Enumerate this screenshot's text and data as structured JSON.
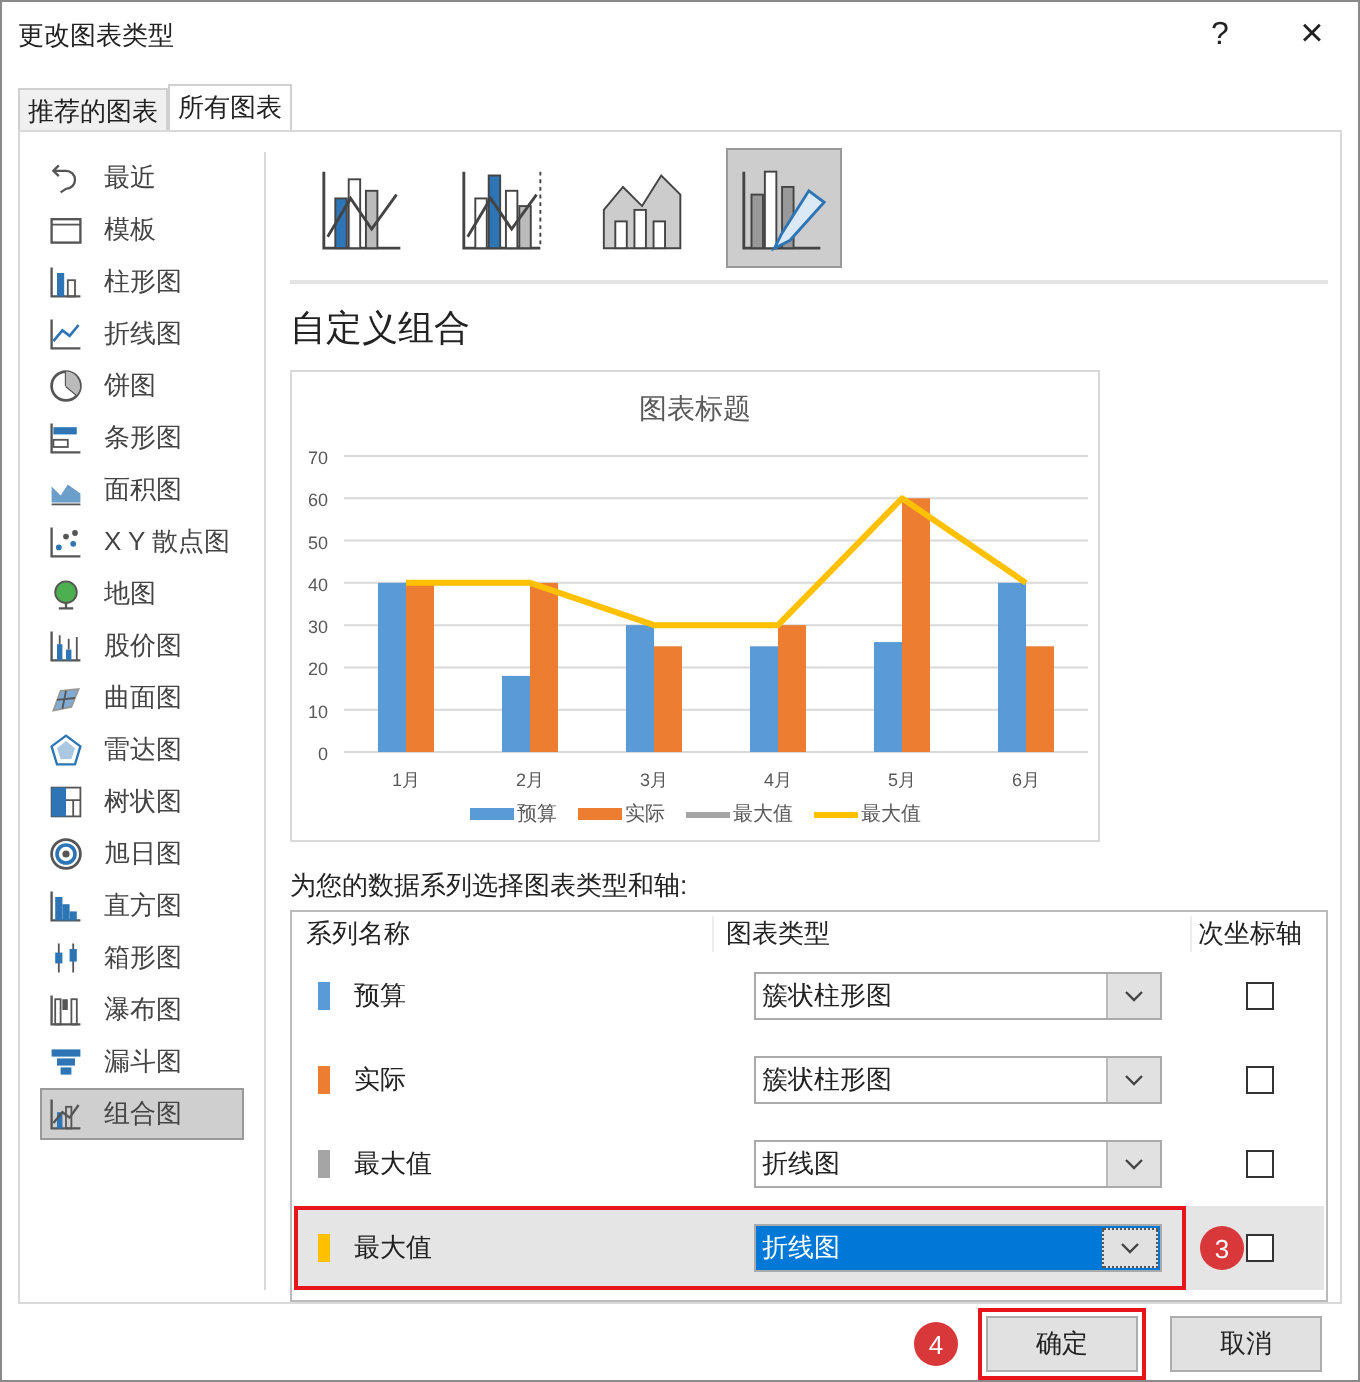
{
  "window": {
    "title": "更改图表类型",
    "help": "?",
    "close": "×"
  },
  "tabs": [
    {
      "label": "推荐的图表",
      "selected": false
    },
    {
      "label": "所有图表",
      "selected": true
    }
  ],
  "sidebar": {
    "items": [
      {
        "label": "最近",
        "selected": false
      },
      {
        "label": "模板",
        "selected": false
      },
      {
        "label": "柱形图",
        "selected": false
      },
      {
        "label": "折线图",
        "selected": false
      },
      {
        "label": "饼图",
        "selected": false
      },
      {
        "label": "条形图",
        "selected": false
      },
      {
        "label": "面积图",
        "selected": false
      },
      {
        "label": "X Y 散点图",
        "selected": false
      },
      {
        "label": "地图",
        "selected": false
      },
      {
        "label": "股价图",
        "selected": false
      },
      {
        "label": "曲面图",
        "selected": false
      },
      {
        "label": "雷达图",
        "selected": false
      },
      {
        "label": "树状图",
        "selected": false
      },
      {
        "label": "旭日图",
        "selected": false
      },
      {
        "label": "直方图",
        "selected": false
      },
      {
        "label": "箱形图",
        "selected": false
      },
      {
        "label": "瀑布图",
        "selected": false
      },
      {
        "label": "漏斗图",
        "selected": false
      },
      {
        "label": "组合图",
        "selected": true
      }
    ]
  },
  "subtypes": [
    {
      "selected": false
    },
    {
      "selected": false
    },
    {
      "selected": false
    },
    {
      "selected": true
    }
  ],
  "heading": "自定义组合",
  "chart_data": {
    "type": "bar",
    "title": "图表标题",
    "categories": [
      "1月",
      "2月",
      "3月",
      "4月",
      "5月",
      "6月"
    ],
    "ylim": [
      0,
      70
    ],
    "grid": true,
    "legend": "bottom",
    "yticks": [
      0,
      10,
      20,
      30,
      40,
      50,
      60,
      70
    ],
    "series": [
      {
        "name": "预算",
        "color": "#5b9bd5",
        "values": [
          40,
          18,
          30,
          25,
          26,
          40
        ]
      },
      {
        "name": "实际",
        "color": "#ed7d31",
        "values": [
          40,
          40,
          25,
          30,
          60,
          25
        ]
      },
      {
        "name": "最大值",
        "color": "#a5a5a5",
        "type": "line",
        "values": [
          null,
          null,
          null,
          null,
          null,
          null
        ]
      },
      {
        "name": "最大值",
        "color": "#ffc000",
        "type": "line",
        "values": [
          40,
          40,
          30,
          30,
          60,
          40
        ]
      }
    ]
  },
  "series_prompt": "为您的数据系列选择图表类型和轴:",
  "series_table": {
    "columns": [
      "系列名称",
      "图表类型",
      "次坐标轴"
    ],
    "rows": [
      {
        "name": "预算",
        "color": "#5b9bd5",
        "chart_type": "簇状柱形图",
        "secondary_axis": false,
        "selected": false
      },
      {
        "name": "实际",
        "color": "#ed7d31",
        "chart_type": "簇状柱形图",
        "secondary_axis": false,
        "selected": false
      },
      {
        "name": "最大值",
        "color": "#a5a5a5",
        "chart_type": "折线图",
        "secondary_axis": false,
        "selected": false
      },
      {
        "name": "最大值",
        "color": "#ffc000",
        "chart_type": "折线图",
        "secondary_axis": false,
        "selected": true,
        "callout": "3"
      }
    ]
  },
  "buttons": [
    {
      "label": "确定",
      "callout": "4"
    },
    {
      "label": "取消"
    }
  ]
}
